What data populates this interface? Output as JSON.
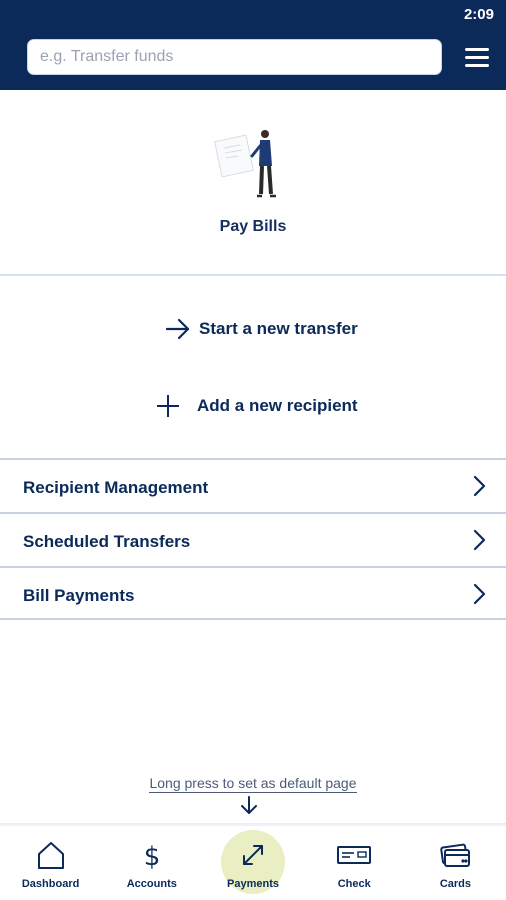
{
  "status": {
    "time": "2:09"
  },
  "search": {
    "placeholder": "e.g. Transfer funds"
  },
  "hero": {
    "title": "Pay Bills"
  },
  "actions": {
    "start_transfer": "Start a new transfer",
    "add_recipient": "Add a new recipient"
  },
  "list": [
    {
      "label": "Recipient Management"
    },
    {
      "label": "Scheduled Transfers"
    },
    {
      "label": "Bill Payments"
    }
  ],
  "hint": "Long press to set as default page",
  "nav": [
    {
      "label": "Dashboard",
      "icon": "home-icon"
    },
    {
      "label": "Accounts",
      "icon": "dollar-icon"
    },
    {
      "label": "Payments",
      "icon": "expand-arrows-icon",
      "active": true
    },
    {
      "label": "Check",
      "icon": "check-icon"
    },
    {
      "label": "Cards",
      "icon": "cards-icon"
    }
  ],
  "colors": {
    "primary": "#0b2a5a",
    "active_highlight": "#e9efc3",
    "divider": "#c7d1e3"
  }
}
